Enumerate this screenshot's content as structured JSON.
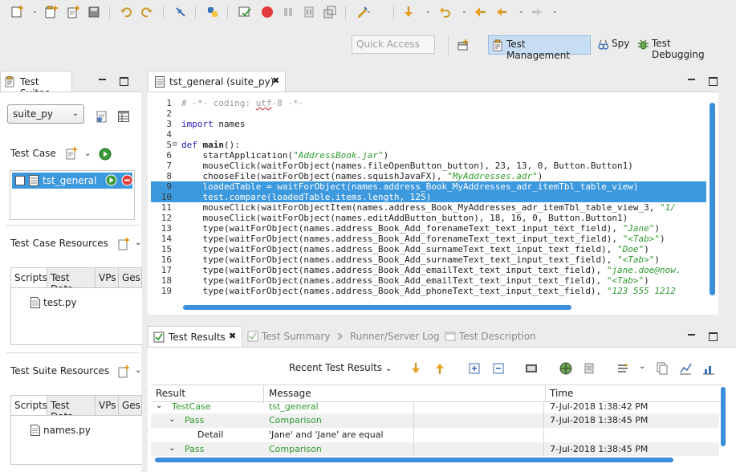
{
  "toolbar": {
    "icons": [
      "new-icon",
      "new-suite-icon",
      "new-testcase-icon",
      "save-icon",
      "undo-icon",
      "redo-icon",
      "pin-icon",
      "python-icon",
      "record-icon",
      "stop-icon",
      "pause-icon",
      "pause-alt-icon",
      "resize-icon",
      "edit-icon",
      "step-over-icon",
      "step-into-icon",
      "back-icon",
      "prev-icon",
      "forward-icon"
    ]
  },
  "quick_access": {
    "placeholder": "Quick Access"
  },
  "perspectives": [
    {
      "label": "Test Management",
      "active": true,
      "icon": "test-management-icon"
    },
    {
      "label": "Spy",
      "active": false,
      "icon": "spy-icon"
    },
    {
      "label": "Test Debugging",
      "active": false,
      "icon": "bug-icon"
    }
  ],
  "left_panel": {
    "tab": "Test Suites",
    "suite_select": "suite_py",
    "test_case_label": "Test Case",
    "test_cases": [
      {
        "name": "tst_general"
      }
    ],
    "resources_label": "Test Case Resources",
    "resources_tabs": [
      "Scripts",
      "Test Data",
      "VPs",
      "Ges"
    ],
    "resources_files": [
      "test.py"
    ],
    "suite_resources_label": "Test Suite Resources",
    "suite_resources_tabs": [
      "Scripts",
      "Test Data",
      "VPs",
      "Ges"
    ],
    "suite_resources_files": [
      "names.py"
    ]
  },
  "editor": {
    "tab": "tst_general (suite_py)",
    "lines": [
      {
        "n": "1",
        "parts": [
          [
            "comment",
            "# -*- coding: "
          ],
          [
            "comment-u",
            "utf"
          ],
          [
            "comment",
            "-8 -*-"
          ]
        ]
      },
      {
        "n": "2",
        "parts": []
      },
      {
        "n": "3",
        "parts": [
          [
            "kw",
            "import"
          ],
          [
            "",
            " names"
          ]
        ]
      },
      {
        "n": "4",
        "parts": []
      },
      {
        "n": "5",
        "fold": true,
        "parts": [
          [
            "kw",
            "def"
          ],
          [
            "",
            " "
          ],
          [
            "bold",
            "main"
          ],
          [
            "",
            "():"
          ]
        ]
      },
      {
        "n": "6",
        "parts": [
          [
            "",
            "    startApplication("
          ],
          [
            "str",
            "\"AddressBook.jar\""
          ],
          [
            "",
            ")"
          ]
        ]
      },
      {
        "n": "7",
        "parts": [
          [
            "",
            "    mouseClick(waitForObject(names.fileOpenButton_button), 23, 13, 0, Button.Button1)"
          ]
        ]
      },
      {
        "n": "8",
        "parts": [
          [
            "",
            "    chooseFile(waitForObject(names.squishJavaFX), "
          ],
          [
            "str",
            "\"MyAddresses.adr\""
          ],
          [
            "",
            ")"
          ]
        ]
      },
      {
        "n": "9",
        "hl": true,
        "parts": [
          [
            "",
            "    loadedTable = waitForObject(names.address_Book_MyAddresses_adr_itemTbl_table_view)"
          ]
        ]
      },
      {
        "n": "10",
        "hl": true,
        "parts": [
          [
            "",
            "    test.compare(loadedTable.items.length, 125)"
          ]
        ]
      },
      {
        "n": "11",
        "parts": [
          [
            "",
            "    mouseClick(waitForObjectItem(names.address_Book_MyAddresses_adr_itemTbl_table_view_3, "
          ],
          [
            "str",
            "\"1/"
          ]
        ]
      },
      {
        "n": "12",
        "parts": [
          [
            "",
            "    mouseClick(waitForObject(names.editAddButton_button), 18, 16, 0, Button.Button1)"
          ]
        ]
      },
      {
        "n": "13",
        "parts": [
          [
            "",
            "    type(waitForObject(names.address_Book_Add_forenameText_text_input_text_field), "
          ],
          [
            "str",
            "\"Jane\""
          ],
          [
            "",
            ")"
          ]
        ]
      },
      {
        "n": "14",
        "parts": [
          [
            "",
            "    type(waitForObject(names.address_Book_Add_forenameText_text_input_text_field), "
          ],
          [
            "str",
            "\"<Tab>\""
          ],
          [
            "",
            ")"
          ]
        ]
      },
      {
        "n": "15",
        "parts": [
          [
            "",
            "    type(waitForObject(names.address_Book_Add_surnameText_text_input_text_field), "
          ],
          [
            "str",
            "\"Doe\""
          ],
          [
            "",
            ")"
          ]
        ]
      },
      {
        "n": "16",
        "parts": [
          [
            "",
            "    type(waitForObject(names.address_Book_Add_surnameText_text_input_text_field), "
          ],
          [
            "str",
            "\"<Tab>\""
          ],
          [
            "",
            ")"
          ]
        ]
      },
      {
        "n": "17",
        "parts": [
          [
            "",
            "    type(waitForObject(names.address_Book_Add_emailText_text_input_text_field), "
          ],
          [
            "str",
            "\"jane.doe@now."
          ]
        ]
      },
      {
        "n": "18",
        "parts": [
          [
            "",
            "    type(waitForObject(names.address_Book_Add_emailText_text_input_text_field), "
          ],
          [
            "str",
            "\"<Tab>\""
          ],
          [
            "",
            ")"
          ]
        ]
      },
      {
        "n": "19",
        "parts": [
          [
            "",
            "    type(waitForObject(names.address_Book_Add_phoneText_text_input_text_field), "
          ],
          [
            "str",
            "\"123 555 1212"
          ]
        ]
      }
    ]
  },
  "results": {
    "tabs": [
      {
        "label": "Test Results",
        "active": true
      },
      {
        "label": "Test Summary",
        "active": false
      },
      {
        "label": "Runner/Server Log",
        "active": false
      },
      {
        "label": "Test Description",
        "active": false
      }
    ],
    "recent_label": "Recent Test Results",
    "columns": [
      "Result",
      "Message",
      "Time"
    ],
    "rows": [
      {
        "indent": 0,
        "expander": "v",
        "result": "TestCase",
        "message": "tst_general",
        "time": "7-Jul-2018 1:38:42 PM",
        "green": true
      },
      {
        "indent": 1,
        "expander": "v",
        "result": "Pass",
        "message": "Comparison",
        "time": "7-Jul-2018 1:38:45 PM",
        "green": true
      },
      {
        "indent": 2,
        "expander": "",
        "result": "Detail",
        "message": "'Jane' and 'Jane' are equal",
        "time": "",
        "green": false
      },
      {
        "indent": 1,
        "expander": "v",
        "result": "Pass",
        "message": "Comparison",
        "time": "7-Jul-2018 1:38:45 PM",
        "green": true
      }
    ]
  }
}
